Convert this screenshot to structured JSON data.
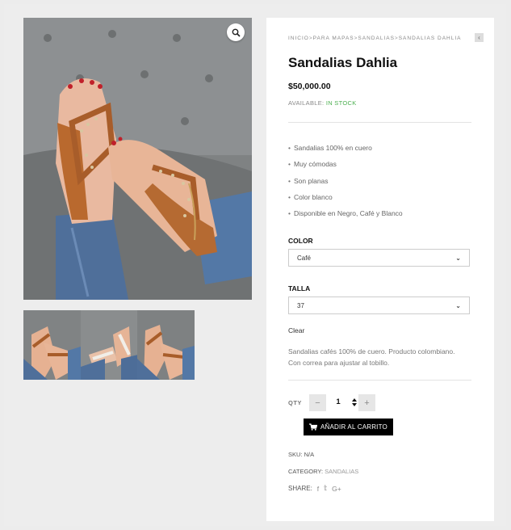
{
  "breadcrumb": [
    "INICIO",
    "PARA MAPAS",
    "SANDALIAS",
    "SANDALIAS DAHLIA"
  ],
  "breadcrumb_sep": ">",
  "product": {
    "title": "Sandalias Dahlia",
    "price": "$50,000.00",
    "availability_label": "AVAILABLE:",
    "availability_value": "IN STOCK"
  },
  "features": [
    "Sandalias 100% en cuero",
    "Muy cómodas",
    "Son planas",
    "Color blanco",
    "Disponible en Negro, Café y Blanco"
  ],
  "color": {
    "label": "COLOR",
    "selected": "Café"
  },
  "size": {
    "label": "TALLA",
    "selected": "37"
  },
  "clear_label": "Clear",
  "description": "Sandalias cafés 100% de cuero. Producto colombiano. Con correa para ajustar al tobillo.",
  "quantity": {
    "label": "QTY",
    "value": "1",
    "minus": "−",
    "plus": "+"
  },
  "add_to_cart_label": "AÑADIR AL CARRITO",
  "sku": {
    "label": "SKU:",
    "value": "N/A"
  },
  "category": {
    "label": "CATEGORY:",
    "value": "SANDALIAS"
  },
  "share": {
    "label": "SHARE:",
    "icons": [
      "f",
      "𝕥",
      "G+"
    ]
  },
  "colors": {
    "in_stock": "#4caf50",
    "button": "#000000",
    "accent_text": "#999999"
  }
}
